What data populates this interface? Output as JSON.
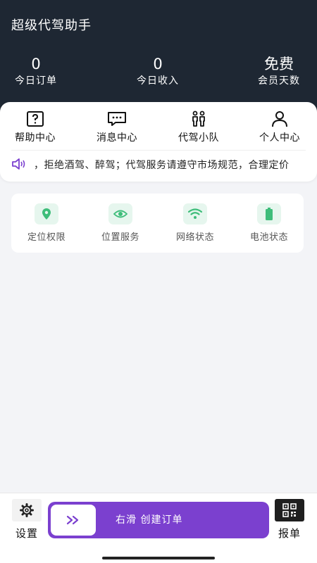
{
  "app": {
    "title": "超级代驾助手"
  },
  "stats": [
    {
      "value": "0",
      "label": "今日订单"
    },
    {
      "value": "0",
      "label": "今日收入"
    },
    {
      "value": "免费",
      "label": "会员天数"
    }
  ],
  "nav": [
    {
      "label": "帮助中心",
      "icon": "help-icon"
    },
    {
      "label": "消息中心",
      "icon": "message-icon"
    },
    {
      "label": "代驾小队",
      "icon": "team-icon"
    },
    {
      "label": "个人中心",
      "icon": "user-icon"
    }
  ],
  "notice": {
    "icon": "speaker-icon",
    "text": "，拒绝酒驾、醉驾；代驾服务请遵守市场规范，合理定价"
  },
  "permissions": [
    {
      "label": "定位权限",
      "icon": "location-pin-icon"
    },
    {
      "label": "位置服务",
      "icon": "eye-target-icon"
    },
    {
      "label": "网络状态",
      "icon": "wifi-icon"
    },
    {
      "label": "电池状态",
      "icon": "battery-icon"
    }
  ],
  "bottom": {
    "settings_label": "设置",
    "slider_text": "右滑  创建订单",
    "report_label": "报单"
  },
  "colors": {
    "header_bg": "#1e2733",
    "accent_purple": "#7b40cf",
    "permission_green": "#3ebd7a"
  }
}
